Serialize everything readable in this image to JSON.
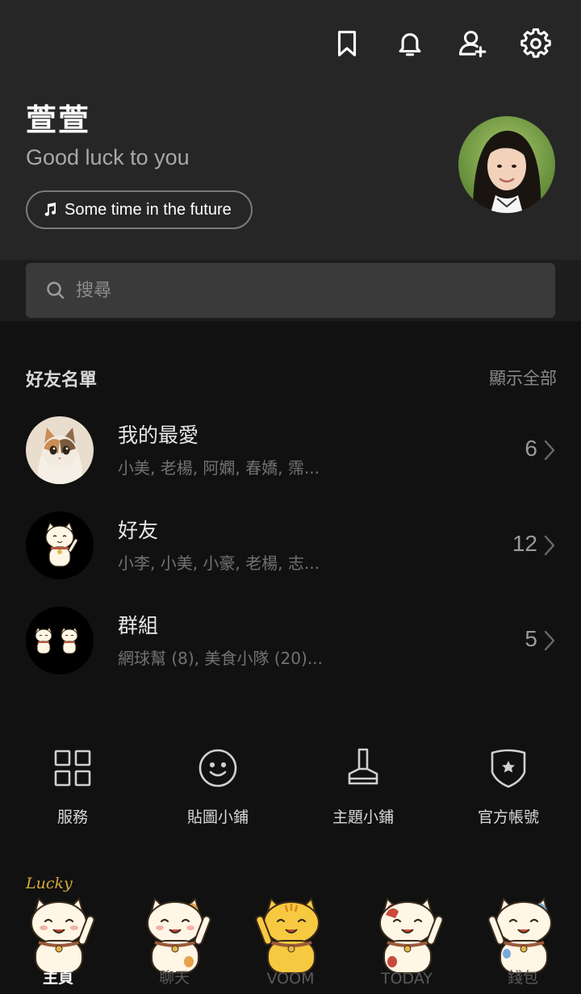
{
  "header": {
    "icons": [
      "bookmark-icon",
      "bell-icon",
      "add-friend-icon",
      "settings-icon"
    ],
    "name": "萱萱",
    "status_message": "Good luck to you",
    "music": "Some time in the future"
  },
  "search": {
    "placeholder": "搜尋"
  },
  "friends_section": {
    "title": "好友名單",
    "show_all": "顯示全部",
    "items": [
      {
        "title": "我的最愛",
        "subtitle": "小美, 老楊, 阿嫻, 春嬌, 霈...",
        "count": "6",
        "avatar": "cat-photo"
      },
      {
        "title": "好友",
        "subtitle": "小李, 小美, 小豪, 老楊, 志...",
        "count": "12",
        "avatar": "lucky-cat"
      },
      {
        "title": "群組",
        "subtitle": "網球幫 (8), 美食小隊 (20)...",
        "count": "5",
        "avatar": "two-lucky-cats"
      }
    ]
  },
  "shortcuts": [
    {
      "label": "服務",
      "icon": "grid-icon"
    },
    {
      "label": "貼圖小鋪",
      "icon": "smiley-icon"
    },
    {
      "label": "主題小鋪",
      "icon": "brush-icon"
    },
    {
      "label": "官方帳號",
      "icon": "shield-star-icon"
    }
  ],
  "tabbar": {
    "lucky_text": "Lucky",
    "tabs": [
      {
        "label": "主頁",
        "active": true
      },
      {
        "label": "聊天",
        "active": false
      },
      {
        "label": "VOOM",
        "active": false
      },
      {
        "label": "TODAY",
        "active": false
      },
      {
        "label": "錢包",
        "active": false
      }
    ]
  },
  "colors": {
    "header_bg": "#262626",
    "body_bg": "#111111",
    "search_bg": "#3a3a3a",
    "accent_gold": "#d8a93a"
  }
}
